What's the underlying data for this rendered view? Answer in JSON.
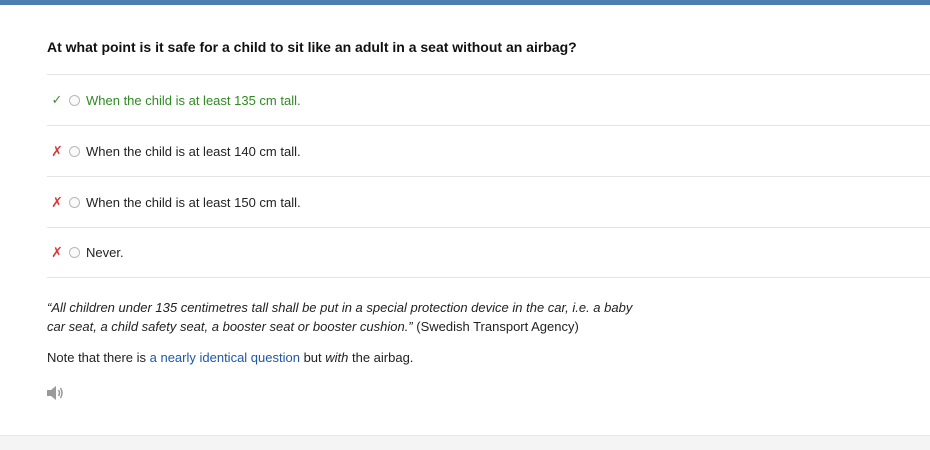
{
  "question": "At what point is it safe for a child to sit like an adult in a seat without an airbag?",
  "answers": [
    {
      "mark": "✓",
      "status": "correct",
      "text": "When the child is at least 135 cm tall."
    },
    {
      "mark": "✗",
      "status": "wrong",
      "text": "When the child is at least 140 cm tall."
    },
    {
      "mark": "✗",
      "status": "wrong",
      "text": "When the child is at least 150 cm tall."
    },
    {
      "mark": "✗",
      "status": "wrong",
      "text": "Never."
    }
  ],
  "explanation": {
    "quote": "“All children under 135 centimetres tall shall be put in a special protection device in the car, i.e. a baby car seat, a child safety seat, a booster seat or booster cushion.”",
    "source": " (Swedish Transport Agency)"
  },
  "note": {
    "prefix": "Note that there is ",
    "link": "a nearly identical question",
    "middle": " but ",
    "emphasis": "with",
    "suffix": " the airbag."
  },
  "icons": {
    "audio": "speaker-icon",
    "correct": "check-icon",
    "wrong": "cross-icon"
  },
  "colors": {
    "accent": "#4c7fb0",
    "correct": "#2f8a22",
    "wrong": "#d23b3b",
    "link": "#1f57a8"
  }
}
